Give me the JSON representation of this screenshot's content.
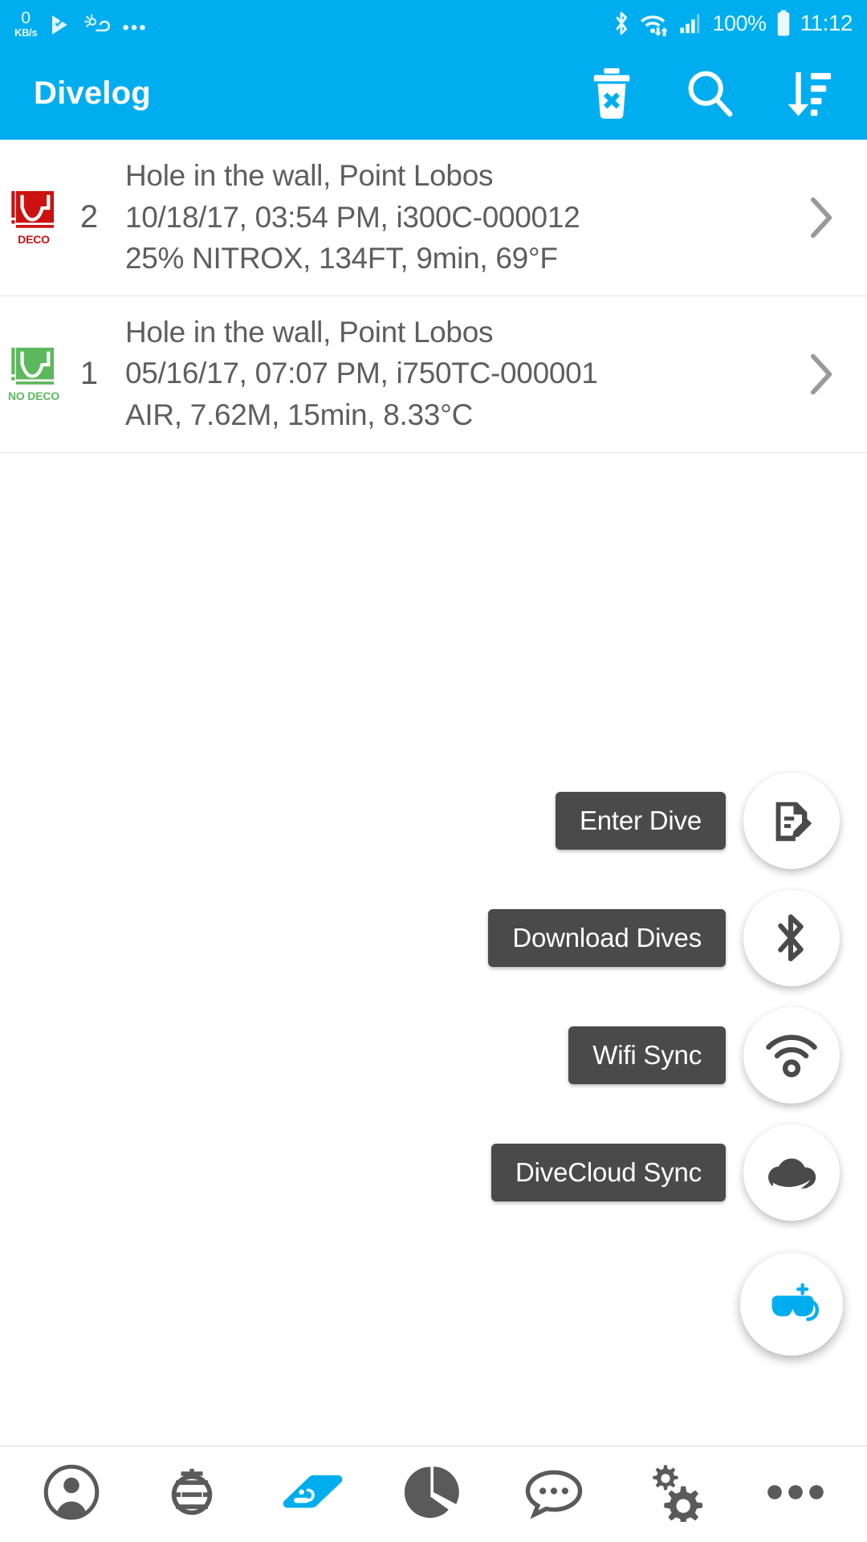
{
  "status_bar": {
    "network_speed_value": "0",
    "network_speed_unit": "KB/s",
    "overflow_dots": "•••",
    "battery_percent": "100%",
    "time": "11:12",
    "icons": [
      "play-store-icon",
      "weather-icon",
      "bluetooth-icon",
      "wifi-icon",
      "cellular-signal-icon",
      "battery-icon"
    ]
  },
  "app_bar": {
    "title": "Divelog",
    "actions": [
      {
        "name": "delete-icon",
        "label": "Delete"
      },
      {
        "name": "search-icon",
        "label": "Search"
      },
      {
        "name": "sort-icon",
        "label": "Sort"
      }
    ]
  },
  "dive_list": [
    {
      "badge_label": "DECO",
      "badge_type": "deco",
      "badge_color": "#CC1111",
      "number": "2",
      "site": "Hole in the wall, Point Lobos",
      "datetime_device": "10/18/17, 03:54 PM, i300C-000012",
      "summary": "25% NITROX, 134FT, 9min, 69°F"
    },
    {
      "badge_label": "NO DECO",
      "badge_type": "nodeco",
      "badge_color": "#5CB85C",
      "number": "1",
      "site": "Hole in the wall, Point Lobos",
      "datetime_device": "05/16/17, 07:07 PM, i750TC-000001",
      "summary": "AIR, 7.62M, 15min, 8.33°C"
    }
  ],
  "fab_menu": {
    "items": [
      {
        "label": "Enter Dive",
        "icon": "document-edit-icon"
      },
      {
        "label": "Download Dives",
        "icon": "bluetooth-icon"
      },
      {
        "label": "Wifi Sync",
        "icon": "wifi-icon"
      },
      {
        "label": "DiveCloud Sync",
        "icon": "cloud-icon"
      }
    ],
    "main_button_icon": "add-dive-mask-icon"
  },
  "bottom_nav": {
    "items": [
      {
        "name": "nav-profile",
        "icon": "person-icon",
        "active": false
      },
      {
        "name": "nav-gear",
        "icon": "equipment-icon",
        "active": false
      },
      {
        "name": "nav-logbook",
        "icon": "logbook-icon",
        "active": true
      },
      {
        "name": "nav-stats",
        "icon": "pie-chart-icon",
        "active": false
      },
      {
        "name": "nav-social",
        "icon": "chat-bubble-icon",
        "active": false
      },
      {
        "name": "nav-settings",
        "icon": "settings-icon",
        "active": false
      },
      {
        "name": "nav-more",
        "icon": "more-icon",
        "active": false
      }
    ]
  },
  "colors": {
    "accent": "#00AEEF",
    "fab_label_bg": "#4A4A4A",
    "text_primary": "#5E5E5E",
    "nav_inactive": "#5A5A5A"
  }
}
